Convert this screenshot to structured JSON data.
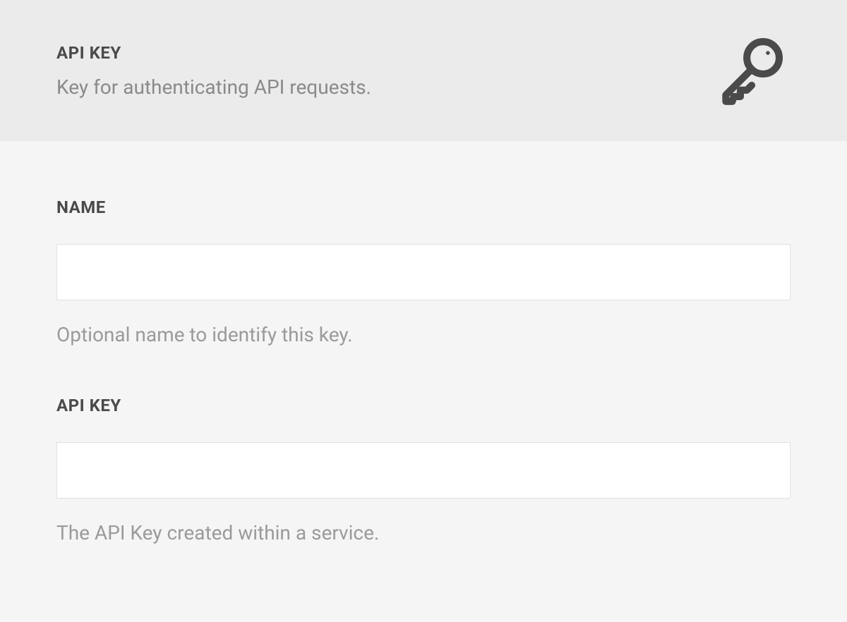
{
  "header": {
    "title": "API KEY",
    "subtitle": "Key for authenticating API requests."
  },
  "fields": {
    "name": {
      "label": "NAME",
      "value": "",
      "help": "Optional name to identify this key."
    },
    "apikey": {
      "label": "API KEY",
      "value": "",
      "help": "The API Key created within a service."
    }
  }
}
